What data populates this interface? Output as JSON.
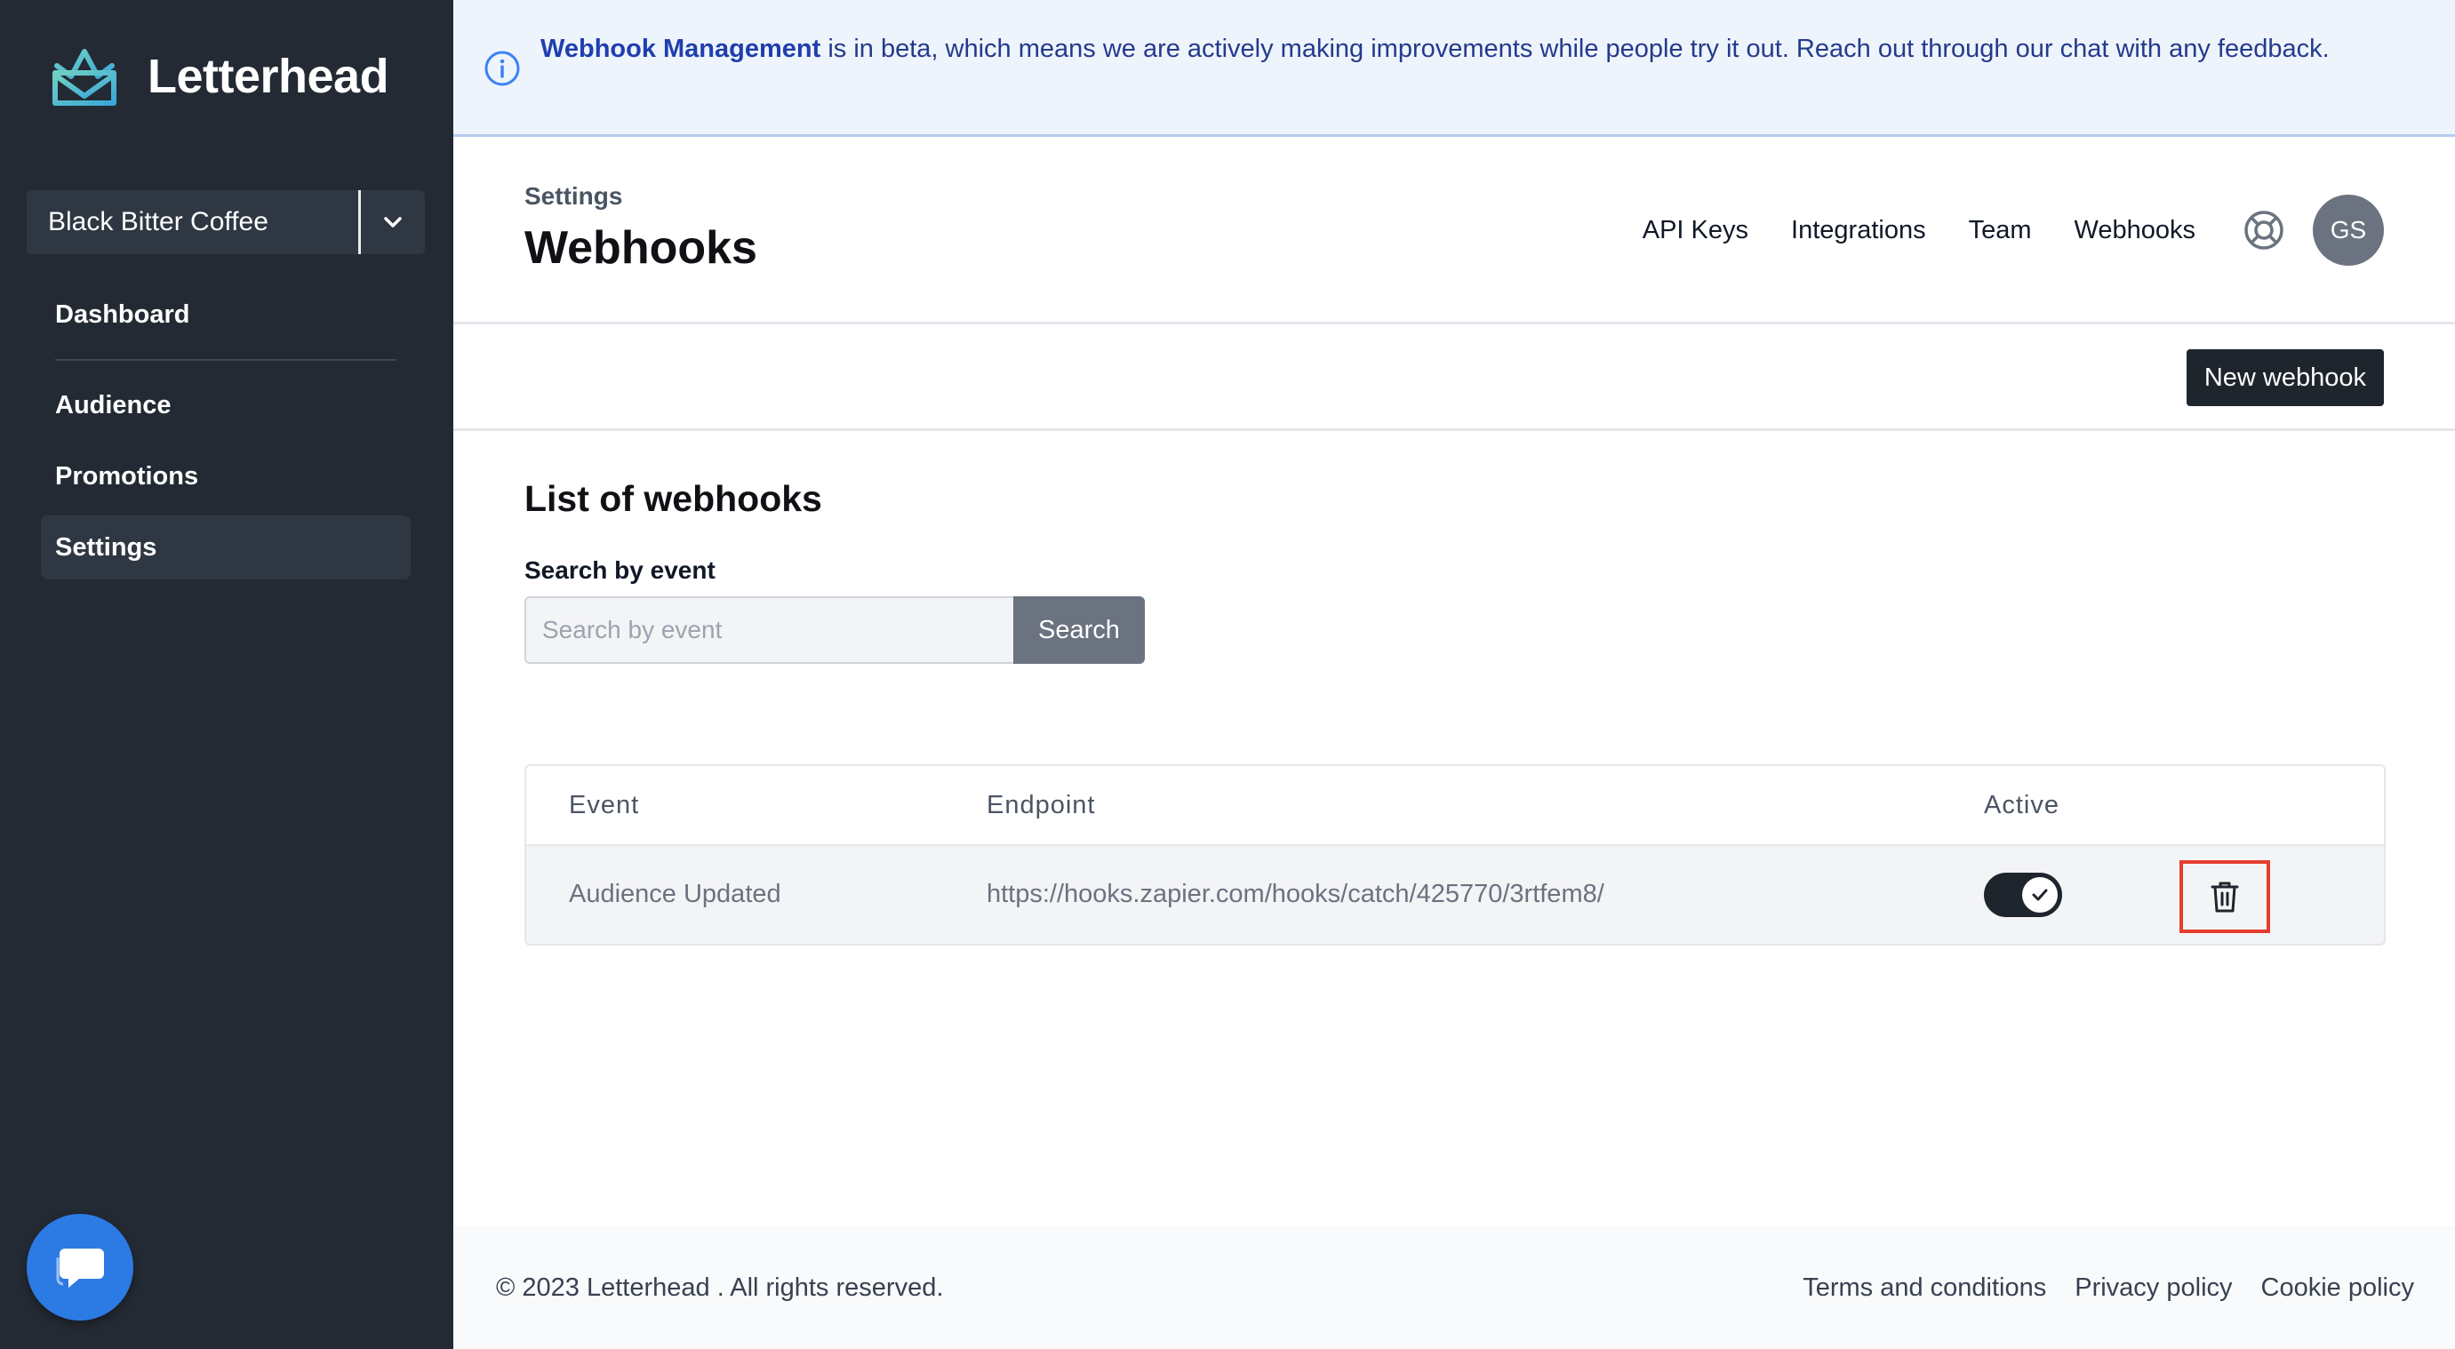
{
  "brand": {
    "name": "Letterhead",
    "logo_icon": "crown-envelope-icon"
  },
  "org_selector": {
    "value": "Black Bitter Coffee",
    "caret_icon": "chevron-down-icon"
  },
  "sidebar": {
    "items": [
      {
        "label": "Dashboard"
      },
      {
        "label": "Audience"
      },
      {
        "label": "Promotions"
      },
      {
        "label": "Settings",
        "active": true
      }
    ]
  },
  "banner": {
    "icon": "info-icon",
    "bold": "Webhook Management",
    "text": " is in beta, which means we are actively making improvements while people try it out. Reach out through our chat with any feedback."
  },
  "header": {
    "breadcrumb": "Settings",
    "title": "Webhooks",
    "nav": [
      "API Keys",
      "Integrations",
      "Team",
      "Webhooks"
    ],
    "help_icon": "lifebuoy-icon",
    "avatar_initials": "GS"
  },
  "actions": {
    "new_webhook_label": "New webhook"
  },
  "list": {
    "title": "List of webhooks",
    "search_label": "Search by event",
    "search_placeholder": "Search by event",
    "search_button": "Search",
    "columns": [
      "Event",
      "Endpoint",
      "Active"
    ],
    "rows": [
      {
        "event": "Audience Updated",
        "endpoint": "https://hooks.zapier.com/hooks/catch/425770/3rtfem8/",
        "active": true
      }
    ]
  },
  "footer": {
    "copyright": "© 2023 Letterhead . All rights reserved.",
    "links": [
      "Terms and conditions",
      "Privacy policy",
      "Cookie policy"
    ]
  },
  "colors": {
    "sidebar_bg": "#232a33",
    "accent_teal": "#3fb8c9",
    "banner_bg": "#eef4fc",
    "banner_text": "#243a8c",
    "dark_button": "#1f252d",
    "delete_highlight": "#e53e2f",
    "chat_blue": "#2c7be5"
  }
}
